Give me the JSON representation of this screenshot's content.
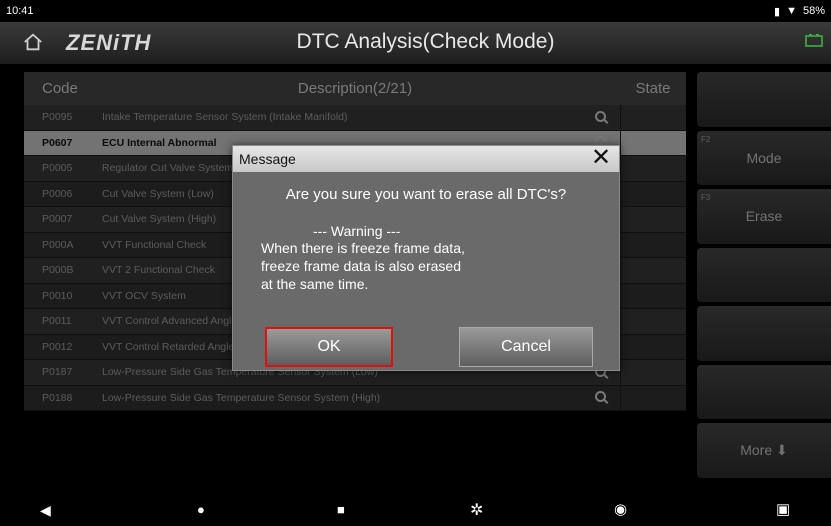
{
  "status": {
    "time": "10:41",
    "battery": "58%"
  },
  "header": {
    "logo": "ZENiTH",
    "title": "DTC Analysis(Check Mode)"
  },
  "table": {
    "headers": {
      "code": "Code",
      "description": "Description(2/21)",
      "state": "State"
    },
    "rows": [
      {
        "code": "P0095",
        "description": "Intake Temperature Sensor System (Intake Manifold)"
      },
      {
        "code": "P0607",
        "description": "ECU Internal Abnormal"
      },
      {
        "code": "P0005",
        "description": "Regulator Cut Valve System"
      },
      {
        "code": "P0006",
        "description": "Cut Valve System (Low)"
      },
      {
        "code": "P0007",
        "description": "Cut Valve System (High)"
      },
      {
        "code": "P000A",
        "description": "VVT Functional Check"
      },
      {
        "code": "P000B",
        "description": "VVT 2 Functional Check"
      },
      {
        "code": "P0010",
        "description": "VVT OCV System"
      },
      {
        "code": "P0011",
        "description": "VVT Control Advanced Angle Abnormal"
      },
      {
        "code": "P0012",
        "description": "VVT Control Retarded Angle Abnormal"
      },
      {
        "code": "P0187",
        "description": "Low-Pressure Side Gas Temperature Sensor System (Low)"
      },
      {
        "code": "P0188",
        "description": "Low-Pressure Side Gas Temperature Sensor System (High)"
      }
    ]
  },
  "side_buttons": [
    {
      "fkey": "",
      "label": ""
    },
    {
      "fkey": "F2",
      "label": "Mode"
    },
    {
      "fkey": "F3",
      "label": "Erase"
    },
    {
      "fkey": "",
      "label": ""
    },
    {
      "fkey": "",
      "label": ""
    },
    {
      "fkey": "",
      "label": ""
    },
    {
      "fkey": "",
      "label": "More ⬇"
    }
  ],
  "dialog": {
    "title": "Message",
    "message": "Are you sure you want to erase all DTC's?",
    "warning_title": "--- Warning ---",
    "warning_lines": [
      "When there is freeze frame data,",
      "freeze frame data is also erased",
      "at the same time."
    ],
    "ok": "OK",
    "cancel": "Cancel"
  },
  "colors": {
    "ok_highlight": "#e01010",
    "selected_row": "#d2d2d2"
  }
}
